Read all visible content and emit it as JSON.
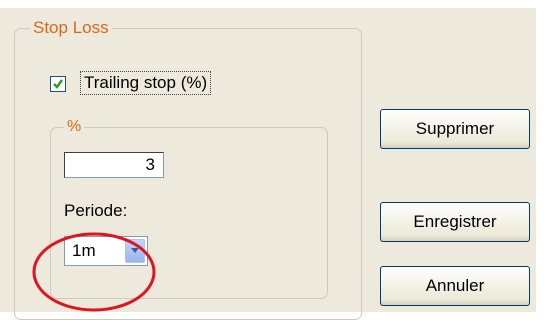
{
  "stop_loss_group": {
    "title": "Stop Loss",
    "trailing_stop": {
      "label": "Trailing stop (%)",
      "checked": true
    },
    "percent_group": {
      "title": "%",
      "percent_value": "3",
      "periode_label": "Periode:",
      "periode_selected": "1m"
    }
  },
  "buttons": {
    "supprimer": "Supprimer",
    "enregistrer": "Enregistrer",
    "annuler": "Annuler"
  },
  "icons": {
    "checkbox": "checkmark-icon",
    "combo": "chevron-down-icon"
  },
  "colors": {
    "group_title": "#e0661b",
    "dialog_bg": "#ede9dc",
    "annotation": "#e0141e"
  }
}
